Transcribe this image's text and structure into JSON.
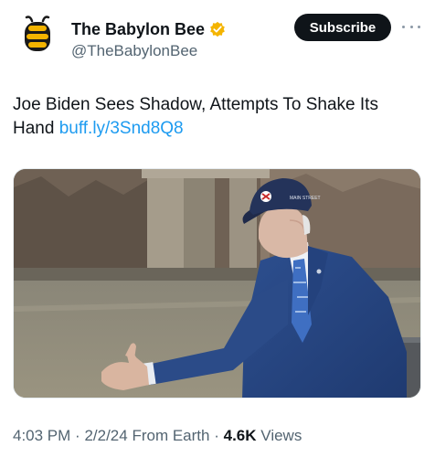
{
  "author": {
    "display_name": "The Babylon Bee",
    "handle": "@TheBabylonBee",
    "avatar_icon": "bee-logo-icon",
    "verified_icon": "verified-badge-icon",
    "verified_color": "#f4b400"
  },
  "actions": {
    "subscribe_label": "Subscribe",
    "more_icon": "more-options-icon"
  },
  "tweet": {
    "text": "Joe Biden Sees Shadow, Attempts To Shake Its Hand",
    "link": "buff.ly/3Snd8Q8",
    "link_color": "#1d9bf0"
  },
  "media": {
    "cap_text": "MAIN STREET"
  },
  "meta": {
    "time": "4:03 PM",
    "date": "2/2/24",
    "source": "From Earth",
    "views_count": "4.6K",
    "views_label": "Views"
  }
}
